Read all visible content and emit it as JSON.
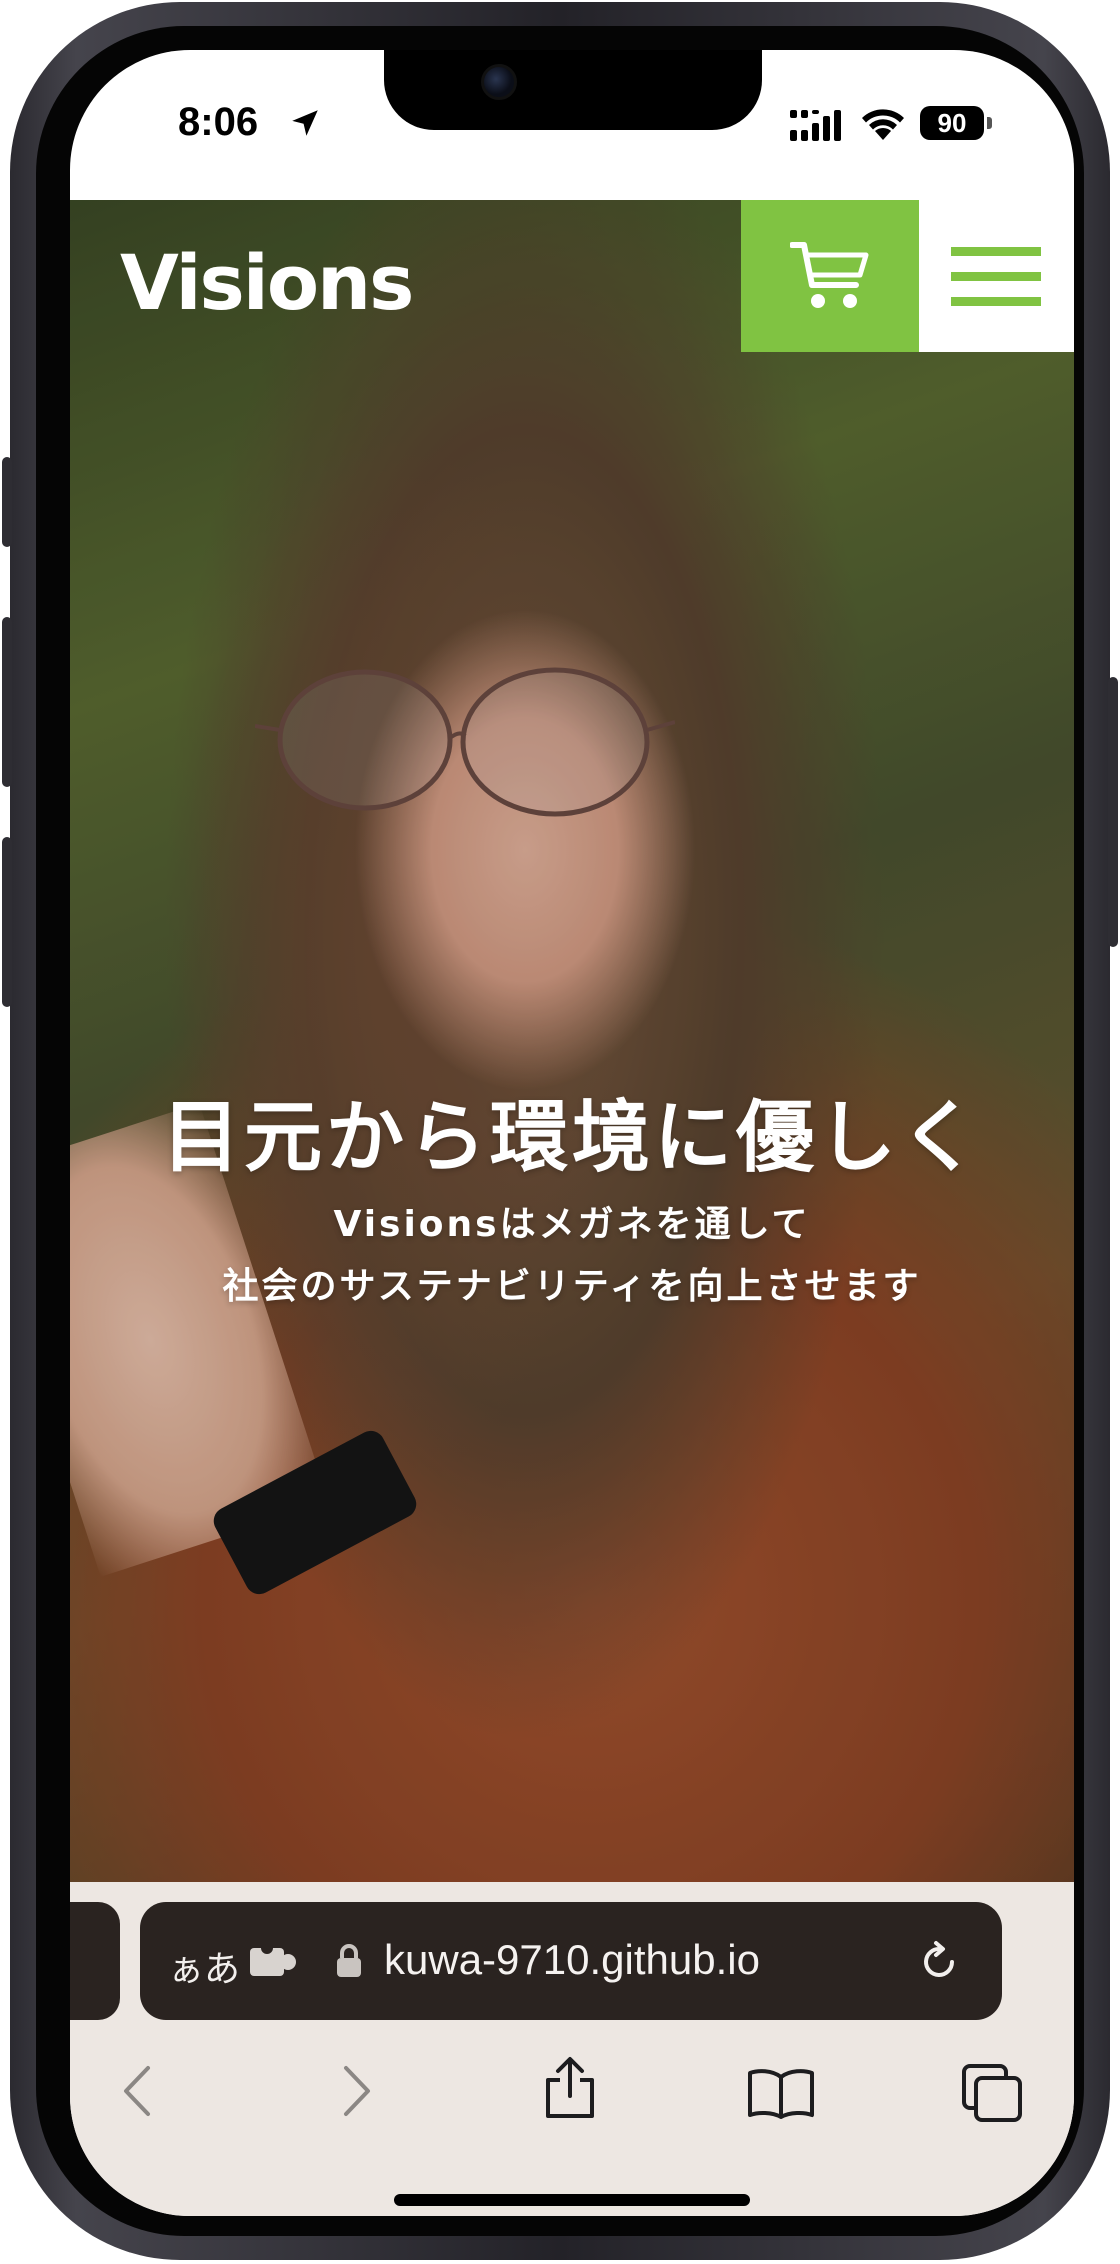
{
  "status_bar": {
    "time": "8:06",
    "battery": "90",
    "icons": [
      "location-arrow-icon",
      "cellular-signal-icon",
      "wifi-icon",
      "battery-icon"
    ]
  },
  "site": {
    "logo": "Visions",
    "cart_icon": "cart-icon",
    "menu_icon": "hamburger-menu-icon",
    "accent_color": "#80c342",
    "hero": {
      "headline": "目元から環境に優しく",
      "subline_1": "Visionsはメガネを通して",
      "subline_2": "社会のサステナビリティを向上させます"
    }
  },
  "browser": {
    "reader_label": "ぁあ",
    "url": "kuwa-9710.github.io",
    "icons": [
      "extension-icon",
      "lock-icon",
      "reload-icon"
    ],
    "toolbar": [
      "back-icon",
      "forward-icon",
      "share-icon",
      "bookmarks-icon",
      "tabs-icon"
    ]
  }
}
